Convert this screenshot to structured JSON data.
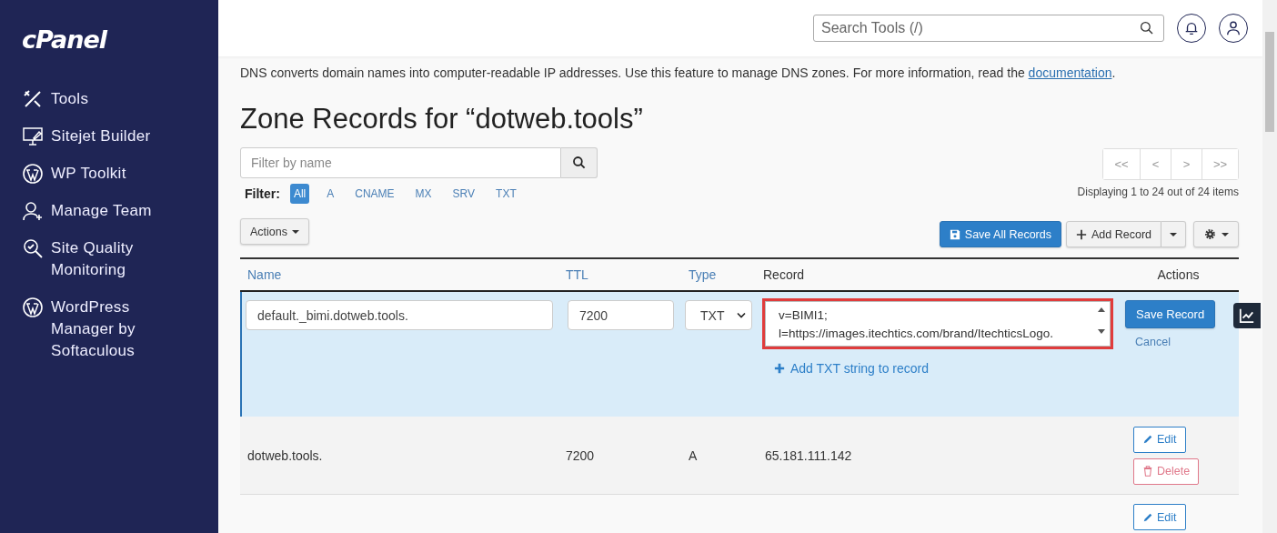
{
  "sidebar": {
    "logo": "cPanel",
    "items": [
      {
        "label": "Tools"
      },
      {
        "label": "Sitejet Builder"
      },
      {
        "label": "WP Toolkit"
      },
      {
        "label": "Manage Team"
      },
      {
        "label": "Site Quality Monitoring"
      },
      {
        "label": "WordPress Manager by Softaculous"
      }
    ]
  },
  "header": {
    "search": {
      "placeholder": "Search Tools (/)"
    }
  },
  "intro": {
    "text": "DNS converts domain names into computer-readable IP addresses. Use this feature to manage DNS zones. For more information, read the",
    "link": "documentation",
    "end": "."
  },
  "title": "Zone Records for “dotweb.tools”",
  "filter_field": {
    "placeholder": "Filter by name"
  },
  "filter": {
    "label": "Filter:",
    "options": [
      {
        "label": "All",
        "selected": true
      },
      {
        "label": "A",
        "selected": false
      },
      {
        "label": "CNAME",
        "selected": false
      },
      {
        "label": "MX",
        "selected": false
      },
      {
        "label": "SRV",
        "selected": false
      },
      {
        "label": "TXT",
        "selected": false
      }
    ]
  },
  "pagination": {
    "buttons": [
      "<<",
      "<",
      ">",
      ">>"
    ],
    "summary": "Displaying 1 to 24 out of 24 items"
  },
  "toolbar": {
    "actions": "Actions",
    "save_all": "Save All Records",
    "add": "Add Record"
  },
  "table": {
    "columns": [
      {
        "label": "Name",
        "sortable": true
      },
      {
        "label": "TTL",
        "sortable": true
      },
      {
        "label": "Type",
        "sortable": true
      },
      {
        "label": "Record",
        "sortable": false
      },
      {
        "label": "Actions",
        "sortable": false
      }
    ],
    "edit_row": {
      "name": "default._bimi.dotweb.tools.",
      "ttl": "7200",
      "type": "TXT",
      "record": "v=BIMI1; l=https://images.itechtics.com/brand/ItechticsLogo.",
      "add_string": "Add TXT string to record",
      "save": "Save Record",
      "cancel": "Cancel"
    },
    "rows": [
      {
        "name": "dotweb.tools.",
        "ttl": "7200",
        "type": "A",
        "record": "65.181.111.142",
        "edit": "Edit",
        "delete": "Delete"
      },
      {
        "edit": "Edit"
      }
    ]
  }
}
